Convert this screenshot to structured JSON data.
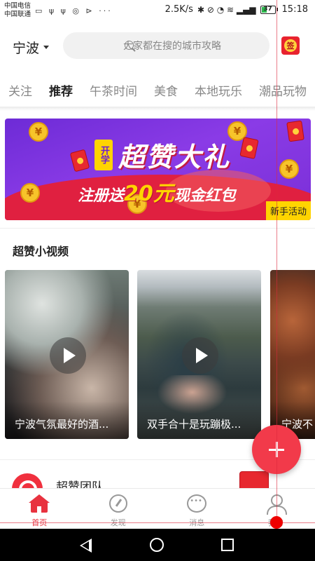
{
  "status": {
    "carrier1": "中国电信",
    "carrier2": "中国联通",
    "left_icons": "▭ ψ ψ ◎ ⊳ ···",
    "speed": "2.5K/s",
    "battery": "37",
    "time": "15:18"
  },
  "header": {
    "city": "宁波",
    "search_placeholder": "大家都在搜的城市攻略",
    "sign_label": "签"
  },
  "tabs": [
    "关注",
    "推荐",
    "午茶时间",
    "美食",
    "本地玩乐",
    "潮品玩物"
  ],
  "active_tab": "推荐",
  "banner": {
    "tag": "开学",
    "title": "超赞大礼",
    "subtitle_prefix": "注册送",
    "amount": "20元",
    "subtitle_suffix": "现金红包",
    "badge": "新手活动"
  },
  "videos_section": {
    "title": "超赞小视频",
    "items": [
      {
        "caption": "宁波气氛最好的酒..."
      },
      {
        "caption": "双手合十是玩蹦极..."
      },
      {
        "caption": "宁波不"
      }
    ]
  },
  "team": {
    "name": "超赞团队"
  },
  "bottom_nav": [
    {
      "label": "首页",
      "icon": "home-icon"
    },
    {
      "label": "发现",
      "icon": "compass-icon"
    },
    {
      "label": "消息",
      "icon": "message-icon"
    },
    {
      "label": "我的",
      "icon": "user-icon"
    }
  ],
  "colors": {
    "accent": "#e8323f",
    "banner_purple": "#7a2fd7",
    "banner_yellow": "#ffd400"
  }
}
